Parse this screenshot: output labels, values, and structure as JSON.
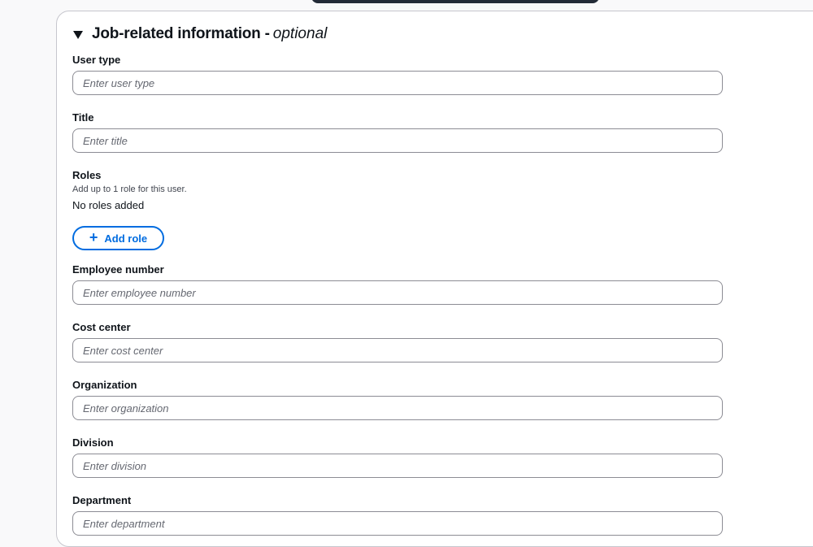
{
  "section": {
    "title": "Job-related information -",
    "optional": "optional"
  },
  "fields": {
    "user_type": {
      "label": "User type",
      "placeholder": "Enter user type"
    },
    "title": {
      "label": "Title",
      "placeholder": "Enter title"
    },
    "employee_number": {
      "label": "Employee number",
      "placeholder": "Enter employee number"
    },
    "cost_center": {
      "label": "Cost center",
      "placeholder": "Enter cost center"
    },
    "organization": {
      "label": "Organization",
      "placeholder": "Enter organization"
    },
    "division": {
      "label": "Division",
      "placeholder": "Enter division"
    },
    "department": {
      "label": "Department",
      "placeholder": "Enter department"
    }
  },
  "roles": {
    "label": "Roles",
    "description": "Add up to 1 role for this user.",
    "empty_text": "No roles added",
    "add_button": "Add role",
    "add_icon": "plus-icon"
  },
  "colors": {
    "accent": "#006ce0",
    "border": "#8c8c94",
    "text": "#0f141a"
  }
}
